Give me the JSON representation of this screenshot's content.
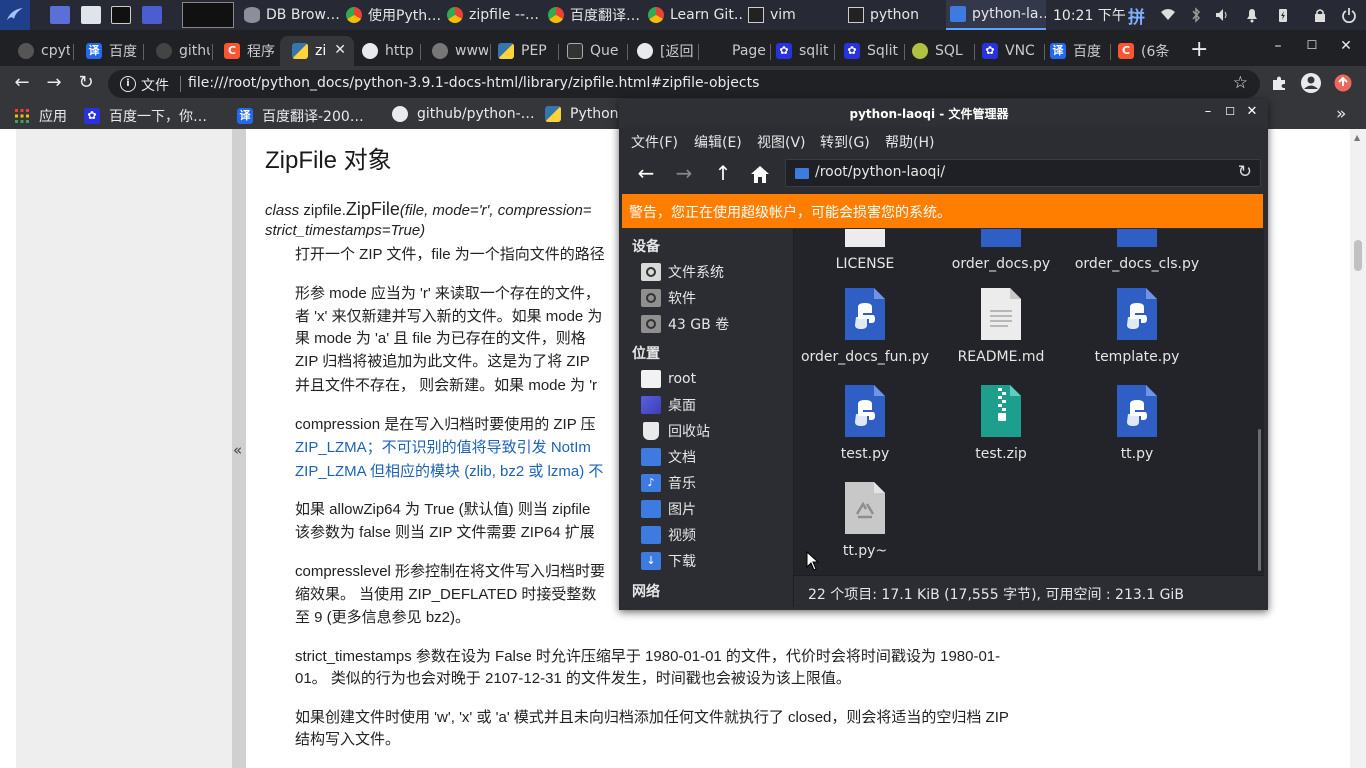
{
  "taskbar": {
    "tasks": [
      {
        "label": "DB Brow…",
        "icon": "database-icon"
      },
      {
        "label": "使用Pyth…",
        "icon": "chrome-icon"
      },
      {
        "label": "zipfile --…",
        "icon": "chrome-icon"
      },
      {
        "label": "百度翻译…",
        "icon": "chrome-icon"
      },
      {
        "label": "Learn Git…",
        "icon": "chrome-icon"
      },
      {
        "label": "vim",
        "icon": "terminal-icon"
      },
      {
        "label": "python",
        "icon": "terminal-icon"
      },
      {
        "label": "python-la…",
        "icon": "folder-icon"
      }
    ],
    "clock": "10:21 下午",
    "ime": "拼"
  },
  "browser": {
    "tabs": [
      {
        "label": "cpyt",
        "icon": "github-icon"
      },
      {
        "label": "百度",
        "icon": "baidu-translate-icon"
      },
      {
        "label": "githu",
        "icon": "github-icon"
      },
      {
        "label": "程序",
        "icon": "csdn-icon"
      },
      {
        "label": "zi",
        "icon": "python-icon"
      },
      {
        "label": "http",
        "icon": "globe-icon"
      },
      {
        "label": "www",
        "icon": "globe-icon"
      },
      {
        "label": "PEP",
        "icon": "python-icon"
      },
      {
        "label": "Que",
        "icon": "stackexchange-icon"
      },
      {
        "label": "[返回",
        "icon": "globe-icon"
      },
      {
        "label": "Page",
        "icon": "page-icon"
      },
      {
        "label": "sqlit",
        "icon": "baidu-icon"
      },
      {
        "label": "Sqlit",
        "icon": "baidu-icon"
      },
      {
        "label": "SQL",
        "icon": "sql-icon"
      },
      {
        "label": "VNC",
        "icon": "baidu-icon"
      },
      {
        "label": "百度",
        "icon": "baidu-translate-icon"
      },
      {
        "label": "(6条",
        "icon": "csdn-icon"
      }
    ],
    "new_tab": "+",
    "omnibox": {
      "scheme_label": "文件",
      "url": "file:///root/python_docs/python-3.9.1-docs-html/library/zipfile.html#zipfile-objects"
    },
    "bookmarks": [
      {
        "label": "应用",
        "icon": "apps-grid-icon"
      },
      {
        "label": "百度一下，你…",
        "icon": "baidu-icon"
      },
      {
        "label": "百度翻译-200…",
        "icon": "baidu-translate-icon"
      },
      {
        "label": "github/python-…",
        "icon": "github-icon"
      },
      {
        "label": "Python",
        "icon": "python-icon"
      }
    ],
    "more_bookmarks": "»"
  },
  "doc": {
    "collapse": "«",
    "heading": "ZipFile 对象",
    "sig": {
      "class_kw": "class",
      "module": "zipfile.",
      "name": "ZipFile",
      "params": "(file, mode='r', compression=",
      "params2": "strict_timestamps=True)"
    },
    "p1": "打开一个 ZIP 文件，file 为一个指向文件的路径",
    "p2_lines": [
      "形参 mode 应当为 'r' 来读取一个存在的文件，",
      "者 'x' 来仅新建并写入新的文件。如果 mode 为",
      "果 mode 为 'a' 且 file 为已存在的文件，则格",
      "ZIP 归档将被追加为此文件。这是为了将 ZIP",
      "并且文件不存在， 则会新建。如果 mode 为 'r"
    ],
    "p3_lines": [
      "compression 是在写入归档时要使用的 ZIP 压",
      "ZIP_LZMA；不可识别的值将导致引发 NotIm",
      "ZIP_LZMA 但相应的模块 (zlib, bz2 或 lzma) 不"
    ],
    "p4_lines": [
      "如果 allowZip64 为 True (默认值) 则当 zipfile",
      "该参数为 false 则当 ZIP 文件需要 ZIP64 扩展"
    ],
    "p5_lines": [
      "compresslevel 形参控制在将文件写入归档时要",
      "缩效果。 当使用 ZIP_DEFLATED 时接受整数",
      "至 9 (更多信息参见 bz2)。"
    ],
    "p6_lines": [
      "strict_timestamps 参数在设为 False 时允许压缩早于 1980-01-01 的文件，代价时会将时间戳设为 1980-01-",
      "01。 类似的行为也会对晚于 2107-12-31 的文件发生，时间戳也会被设为该上限值。"
    ],
    "p7_lines": [
      "如果创建文件时使用 'w', 'x' 或 'a' 模式并且未向归档添加任何文件就执行了 closed，则会将适当的空归档 ZIP",
      "结构写入文件。"
    ]
  },
  "file_manager": {
    "title": "python-laoqi - 文件管理器",
    "menus": [
      "文件(F)",
      "编辑(E)",
      "视图(V)",
      "转到(G)",
      "帮助(H)"
    ],
    "path": "/root/python-laoqi/",
    "warning": "警告，您正在使用超级帐户，可能会损害您的系统。",
    "sections": {
      "devices": "设备",
      "places": "位置",
      "network": "网络"
    },
    "devices": [
      {
        "label": "文件系统",
        "icon": "drive-icon"
      },
      {
        "label": "软件",
        "icon": "drive-icon"
      },
      {
        "label": "43 GB 卷",
        "icon": "drive-icon"
      }
    ],
    "places": [
      {
        "label": "root",
        "icon": "home-folder-icon"
      },
      {
        "label": "桌面",
        "icon": "desktop-icon"
      },
      {
        "label": "回收站",
        "icon": "trash-icon"
      },
      {
        "label": "文档",
        "icon": "documents-folder-icon"
      },
      {
        "label": "音乐",
        "icon": "music-folder-icon"
      },
      {
        "label": "图片",
        "icon": "pictures-folder-icon"
      },
      {
        "label": "视频",
        "icon": "videos-folder-icon"
      },
      {
        "label": "下载",
        "icon": "downloads-folder-icon"
      }
    ],
    "files": [
      {
        "name": "LICENSE",
        "icon": "text-file-icon"
      },
      {
        "name": "order_docs.py",
        "icon": "python-file-icon"
      },
      {
        "name": "order_docs_cls.py",
        "icon": "python-file-icon"
      },
      {
        "name": "order_docs_fun.py",
        "icon": "python-file-icon"
      },
      {
        "name": "README.md",
        "icon": "text-file-icon"
      },
      {
        "name": "template.py",
        "icon": "python-file-icon"
      },
      {
        "name": "test.py",
        "icon": "python-file-icon"
      },
      {
        "name": "test.zip",
        "icon": "zip-file-icon"
      },
      {
        "name": "tt.py",
        "icon": "python-file-icon"
      },
      {
        "name": "tt.py~",
        "icon": "backup-file-icon"
      }
    ],
    "status": "22 个项目: 17.1 KiB (17,555 字节), 可用空间 : 213.1 GiB"
  }
}
